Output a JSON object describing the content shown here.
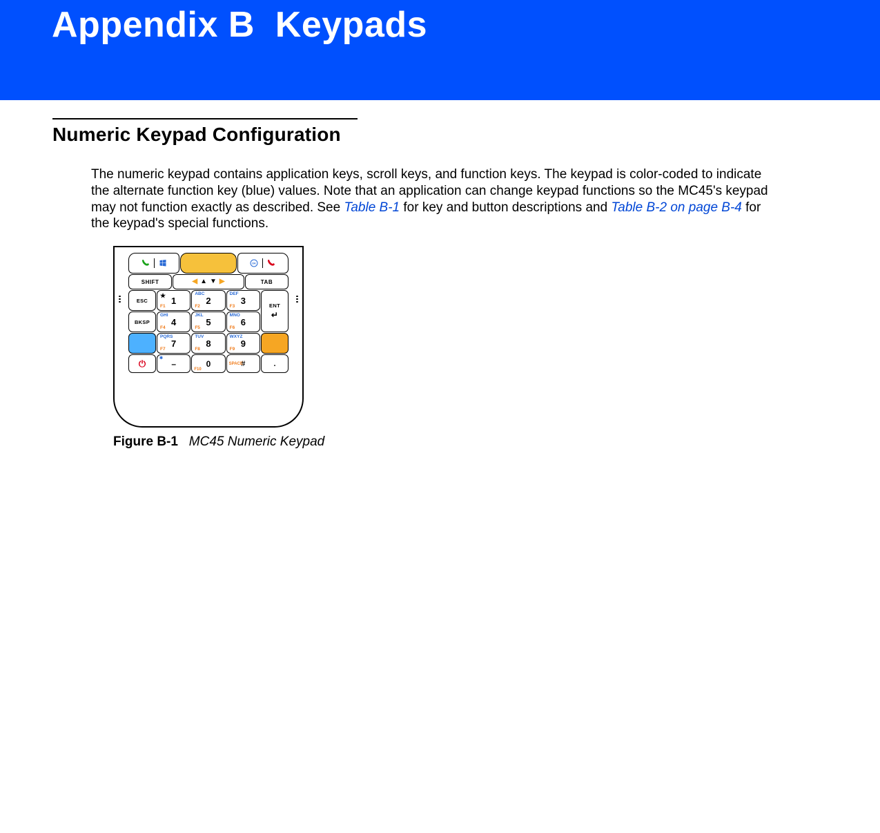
{
  "banner": {
    "title": "Appendix B  Keypads"
  },
  "section": {
    "heading": "Numeric Keypad Configuration",
    "para_part1": "The numeric keypad contains application keys, scroll keys, and function keys. The keypad is color-coded to indicate the alternate function key (blue) values. Note that an application can change keypad functions so the MC45's keypad may not function exactly as described. See ",
    "link1": "Table B-1",
    "para_part2": " for key and button descriptions and ",
    "link2": "Table B-2 on page B-4",
    "para_part3": " for the keypad's special functions."
  },
  "figure": {
    "label": "Figure B-1",
    "caption": "MC45 Numeric Keypad"
  },
  "keypad": {
    "shift": "SHIFT",
    "tab": "TAB",
    "esc": "ESC",
    "bksp": "BKSP",
    "ent": "ENT",
    "keys": {
      "1": {
        "num": "1",
        "alpha": "",
        "fn": "F1",
        "star": "★"
      },
      "2": {
        "num": "2",
        "alpha": "ABC",
        "fn": "F2"
      },
      "3": {
        "num": "3",
        "alpha": "DEF",
        "fn": "F3"
      },
      "4": {
        "num": "4",
        "alpha": "GHI",
        "fn": "F4"
      },
      "5": {
        "num": "5",
        "alpha": "JKL",
        "fn": "F5"
      },
      "6": {
        "num": "6",
        "alpha": "MNO",
        "fn": "F6"
      },
      "7": {
        "num": "7",
        "alpha": "PQRS",
        "fn": "F7"
      },
      "8": {
        "num": "8",
        "alpha": "TUV",
        "fn": "F8"
      },
      "9": {
        "num": "9",
        "alpha": "WXYZ",
        "fn": "F9"
      },
      "0": {
        "num": "0",
        "alpha": "",
        "fn": "F10"
      }
    },
    "bottom": {
      "dash": "–",
      "asterisk": "✱",
      "pound": "#",
      "space": "SPACE",
      "dot": "."
    }
  }
}
